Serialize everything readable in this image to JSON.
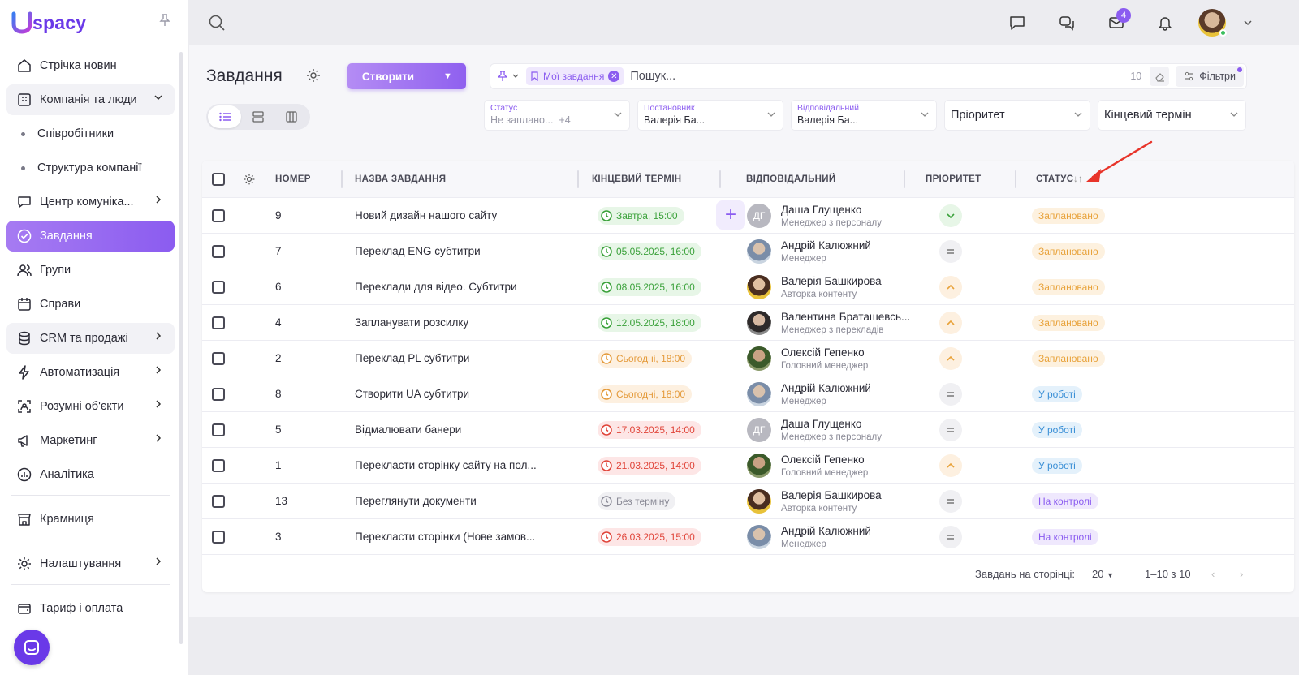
{
  "app": {
    "logo_text": "spacy",
    "brand_color": "#6a39e8",
    "accent_color": "#8b5cf0"
  },
  "sidebar": {
    "items": [
      {
        "label": "Стрічка новин",
        "icon": "home-icon"
      },
      {
        "label": "Компанія та люди",
        "icon": "building-icon",
        "expanded": true
      },
      {
        "label": "Співробітники",
        "sub": true
      },
      {
        "label": "Структура компанії",
        "sub": true
      },
      {
        "label": "Центр комуніка...",
        "icon": "chat-icon"
      },
      {
        "label": "Завдання",
        "icon": "check-circle-icon",
        "active": true
      },
      {
        "label": "Групи",
        "icon": "users-icon"
      },
      {
        "label": "Справи",
        "icon": "calendar-icon"
      },
      {
        "label": "CRM та продажі",
        "icon": "database-icon"
      },
      {
        "label": "Автоматизація",
        "icon": "bolt-icon"
      },
      {
        "label": "Розумні об'єкти",
        "icon": "scan-icon"
      },
      {
        "label": "Маркетинг",
        "icon": "megaphone-icon"
      },
      {
        "label": "Аналітика",
        "icon": "chart-icon"
      },
      {
        "label": "Крамниця",
        "icon": "store-icon"
      },
      {
        "label": "Налаштування",
        "icon": "gear-icon"
      },
      {
        "label": "Тариф і оплата",
        "icon": "wallet-icon"
      }
    ]
  },
  "topbar": {
    "mail_badge": "4"
  },
  "header": {
    "title": "Завдання",
    "create_label": "Створити",
    "search_placeholder": "Пошук...",
    "chip_label": "Мої завдання",
    "count": "10",
    "filters_label": "Фільтри"
  },
  "filters": {
    "status_label": "Статус",
    "status_value": "Не заплано...",
    "status_more": "+4",
    "creator_label": "Постановник",
    "creator_value": "Валерія Ба...",
    "responsible_label": "Відповідальний",
    "responsible_value": "Валерія Ба...",
    "priority_label": "Пріоритет",
    "deadline_label": "Кінцевий термін"
  },
  "table": {
    "columns": [
      "НОМЕР",
      "НАЗВА ЗАВДАННЯ",
      "КІНЦЕВИЙ ТЕРМІН",
      "ВІДПОВІДАЛЬНИЙ",
      "ПРІОРИТЕТ",
      "СТАТУС"
    ],
    "sort_indicator": "↓↑",
    "rows": [
      {
        "num": "9",
        "name": "Новий дизайн нашого сайту",
        "deadline": "Завтра, 15:00",
        "dl": "green",
        "resp": "Даша Глущенко",
        "role": "Менеджер з персоналу",
        "ava": "init",
        "initials": "ДГ",
        "prio": "low",
        "status": "Заплановано",
        "st": "planned"
      },
      {
        "num": "7",
        "name": "Переклад ENG субтитри",
        "deadline": "05.05.2025, 16:00",
        "dl": "green",
        "resp": "Андрій Калюжний",
        "role": "Менеджер",
        "ava": "a",
        "prio": "mid",
        "status": "Заплановано",
        "st": "planned"
      },
      {
        "num": "6",
        "name": "Переклади для відео. Субтитри",
        "deadline": "08.05.2025, 16:00",
        "dl": "green",
        "resp": "Валерія Башкирова",
        "role": "Авторка контенту",
        "ava": "v",
        "prio": "high",
        "status": "Заплановано",
        "st": "planned"
      },
      {
        "num": "4",
        "name": "Запланувати розсилку",
        "deadline": "12.05.2025, 18:00",
        "dl": "green",
        "resp": "Валентина Браташевсь...",
        "role": "Менеджер з перекладів",
        "ava": "b",
        "prio": "high",
        "status": "Заплановано",
        "st": "planned"
      },
      {
        "num": "2",
        "name": "Переклад PL субтитри",
        "deadline": "Сьогодні, 18:00",
        "dl": "orange",
        "resp": "Олексій Гепенко",
        "role": "Головний менеджер",
        "ava": "o",
        "prio": "high",
        "status": "Заплановано",
        "st": "planned"
      },
      {
        "num": "8",
        "name": "Створити UA субтитри",
        "deadline": "Сьогодні, 18:00",
        "dl": "orange",
        "resp": "Андрій Калюжний",
        "role": "Менеджер",
        "ava": "a",
        "prio": "mid",
        "status": "У роботі",
        "st": "work"
      },
      {
        "num": "5",
        "name": "Відмалювати банери",
        "deadline": "17.03.2025, 14:00",
        "dl": "red",
        "resp": "Даша Глущенко",
        "role": "Менеджер з персоналу",
        "ava": "init",
        "initials": "ДГ",
        "prio": "mid",
        "status": "У роботі",
        "st": "work"
      },
      {
        "num": "1",
        "name": "Перекласти сторінку сайту на пол...",
        "deadline": "21.03.2025, 14:00",
        "dl": "red",
        "resp": "Олексій Гепенко",
        "role": "Головний менеджер",
        "ava": "o",
        "prio": "high",
        "status": "У роботі",
        "st": "work"
      },
      {
        "num": "13",
        "name": "Переглянути документи",
        "deadline": "Без терміну",
        "dl": "grey",
        "resp": "Валерія Башкирова",
        "role": "Авторка контенту",
        "ava": "v",
        "prio": "mid",
        "status": "На контролі",
        "st": "control"
      },
      {
        "num": "3",
        "name": "Перекласти сторінки (Нове замов...",
        "deadline": "26.03.2025, 15:00",
        "dl": "red",
        "resp": "Андрій Калюжний",
        "role": "Менеджер",
        "ava": "a",
        "prio": "mid",
        "status": "На контролі",
        "st": "control"
      }
    ]
  },
  "pagination": {
    "per_page_label": "Завдань на сторінці:",
    "per_page": "20",
    "range": "1–10 з 10"
  }
}
